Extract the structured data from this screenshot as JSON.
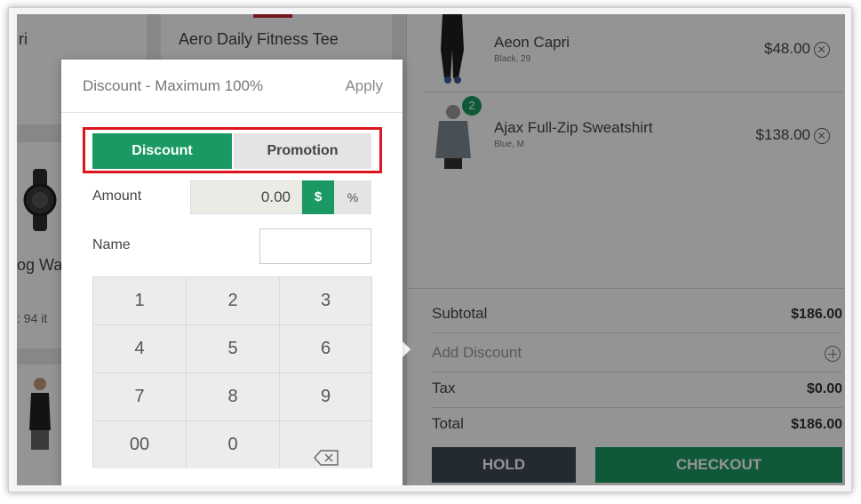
{
  "background": {
    "tiles": {
      "top_left_partial": "ri",
      "top_middle": "Aero Daily Fitness Tee",
      "mid_left_partial": "og Wa",
      "stock_partial": ": 94 it"
    }
  },
  "cart": {
    "items": [
      {
        "name": "Aeon Capri",
        "variant": "Black, 29",
        "price": "$48.00",
        "qty": ""
      },
      {
        "name": "Ajax Full-Zip Sweatshirt",
        "variant": "Blue, M",
        "price": "$138.00",
        "qty": "2"
      }
    ],
    "totals": {
      "subtotal_label": "Subtotal",
      "subtotal_value": "$186.00",
      "add_discount_label": "Add Discount",
      "tax_label": "Tax",
      "tax_value": "$0.00",
      "total_label": "Total",
      "total_value": "$186.00"
    },
    "hold_label": "HOLD",
    "checkout_label": "CHECKOUT"
  },
  "popup": {
    "title": "Discount - Maximum 100%",
    "apply_label": "Apply",
    "tabs": {
      "discount": "Discount",
      "promotion": "Promotion"
    },
    "amount_label": "Amount",
    "amount_value": "0.00",
    "unit_dollar": "$",
    "unit_percent": "%",
    "name_label": "Name",
    "name_value": "",
    "keypad": [
      "1",
      "2",
      "3",
      "4",
      "5",
      "6",
      "7",
      "8",
      "9",
      "00",
      "0"
    ]
  },
  "colors": {
    "accent_green": "#1a9a62",
    "hold_dark": "#3f4956",
    "highlight_red": "#e0141e"
  }
}
